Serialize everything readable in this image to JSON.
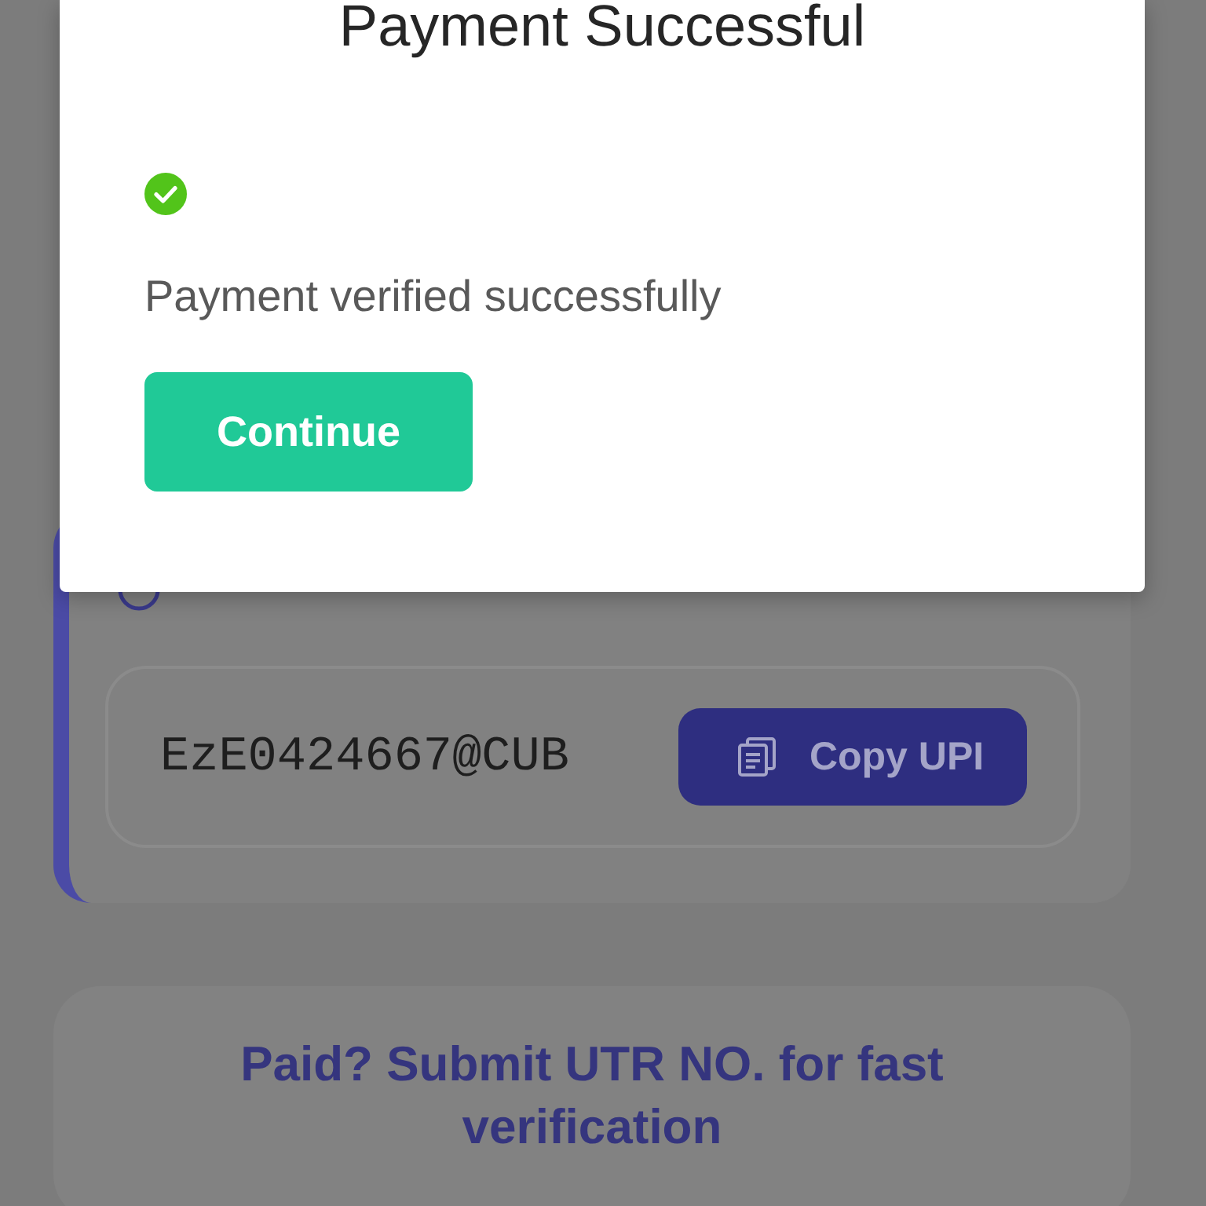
{
  "modal": {
    "title": "Payment Successful",
    "verified": true,
    "message": "Payment verified successfully",
    "button": "Continue"
  },
  "manual_transfer": {
    "upi_id": "EzE0424667@CUB",
    "copy_button": "Copy UPI"
  },
  "utr_section": {
    "title": "Paid? Submit UTR NO. for fast verification"
  }
}
